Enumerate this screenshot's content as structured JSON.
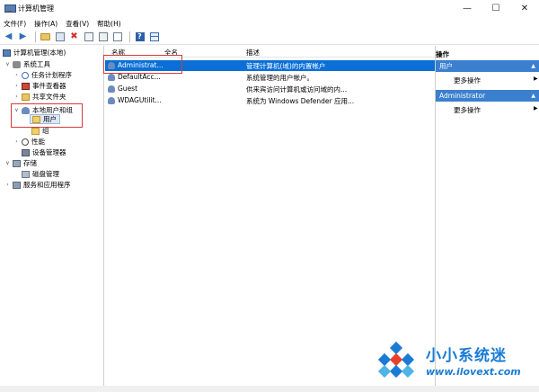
{
  "window": {
    "title": "计算机管理"
  },
  "menu": [
    "文件(F)",
    "操作(A)",
    "查看(V)",
    "帮助(H)"
  ],
  "tree": {
    "root": "计算机管理(本地)",
    "system_tools": "系统工具",
    "task_scheduler": "任务计划程序",
    "event_viewer": "事件查看器",
    "shared_folders": "共享文件夹",
    "local_users_groups": "本地用户和组",
    "users": "用户",
    "groups": "组",
    "performance": "性能",
    "device_manager": "设备管理器",
    "storage": "存储",
    "disk_management": "磁盘管理",
    "services_apps": "服务和应用程序"
  },
  "list": {
    "columns": [
      "名称",
      "全名",
      "描述"
    ],
    "rows": [
      {
        "name": "Administrat...",
        "full": "",
        "desc": "管理计算机(域)的内置帐户",
        "selected": true
      },
      {
        "name": "DefaultAcc...",
        "full": "",
        "desc": "系统管理的用户帐户。",
        "selected": false
      },
      {
        "name": "Guest",
        "full": "",
        "desc": "供来宾访问计算机或访问域的内...",
        "selected": false
      },
      {
        "name": "WDAGUtilit...",
        "full": "",
        "desc": "系统为 Windows Defender 应用...",
        "selected": false
      }
    ]
  },
  "actions": {
    "title": "操作",
    "section1": "用户",
    "more1": "更多操作",
    "section2": "Administrator",
    "more2": "更多操作"
  },
  "watermark": {
    "title": "小小系统迷",
    "url": "www.ilovext.com"
  },
  "colors": {
    "accent": "#0a6fd6",
    "section": "#3b7fcf",
    "highlight": "#d63a3a",
    "brand": "#1a7bd4"
  }
}
